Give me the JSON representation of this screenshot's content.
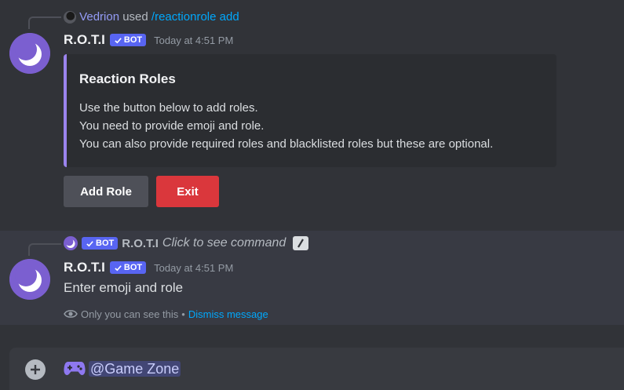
{
  "message1": {
    "reply_user": "Vedrion",
    "reply_used": "used",
    "reply_command": "/reactionrole add",
    "author": "R.O.T.I",
    "bot_label": "BOT",
    "timestamp": "Today at 4:51 PM",
    "embed": {
      "title": "Reaction Roles",
      "lines": [
        "Use the button below to add roles.",
        "You need to provide emoji and role.",
        "You can also provide required roles and blacklisted roles but these are optional."
      ]
    },
    "buttons": {
      "add_role": "Add Role",
      "exit": "Exit"
    }
  },
  "message2": {
    "reply_bot_label": "BOT",
    "reply_author": "R.O.T.I",
    "reply_hint": "Click to see command",
    "author": "R.O.T.I",
    "bot_label": "BOT",
    "timestamp": "Today at 4:51 PM",
    "text": "Enter emoji and role",
    "ephemeral_note": "Only you can see this",
    "separator": "•",
    "dismiss": "Dismiss message"
  },
  "composer": {
    "mention": "@Game Zone"
  },
  "colors": {
    "background": "#313338",
    "embed_border": "#9b84ee",
    "exit_button": "#da373c",
    "add_role_button": "#4e5058",
    "link": "#00a8fc",
    "bot_tag": "#5865f2"
  }
}
